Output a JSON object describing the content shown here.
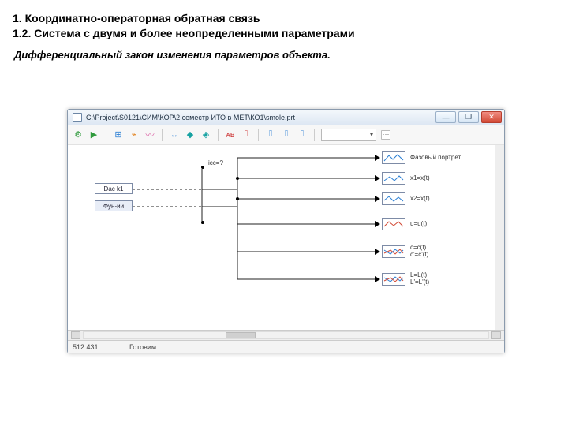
{
  "slide": {
    "h1": "1. Координатно-операторная обратная связь",
    "h2": "1.2. Система с двумя и более неопределенными параметрами",
    "sub": "Дифференциальный закон изменения параметров объекта."
  },
  "window": {
    "title": "C:\\Project\\S0121\\СИМ\\КОР\\2 семестр ИТО в МЕТ\\КО1\\smole.prt",
    "buttons": {
      "min": "—",
      "max": "❐",
      "close": "✕"
    }
  },
  "toolbar": {
    "combo_caret": "▾",
    "dots": "⋯"
  },
  "diagram": {
    "block_left_top": "Dac k1",
    "block_left_bot": "Фун-ии",
    "cluster_label": "icc=?",
    "outputs": {
      "o1": "Фазовый портрет",
      "o2": "x1=x(t)",
      "o3": "x2=x(t)",
      "o4": "u=u(t)",
      "o5a": "c=c(t)",
      "o5b": "c'=c'(t)",
      "o6a": "L=L(t)",
      "o6b": "L'=L'(t)"
    }
  },
  "statusbar": {
    "field1": "512  431",
    "field2": "Готовим"
  }
}
